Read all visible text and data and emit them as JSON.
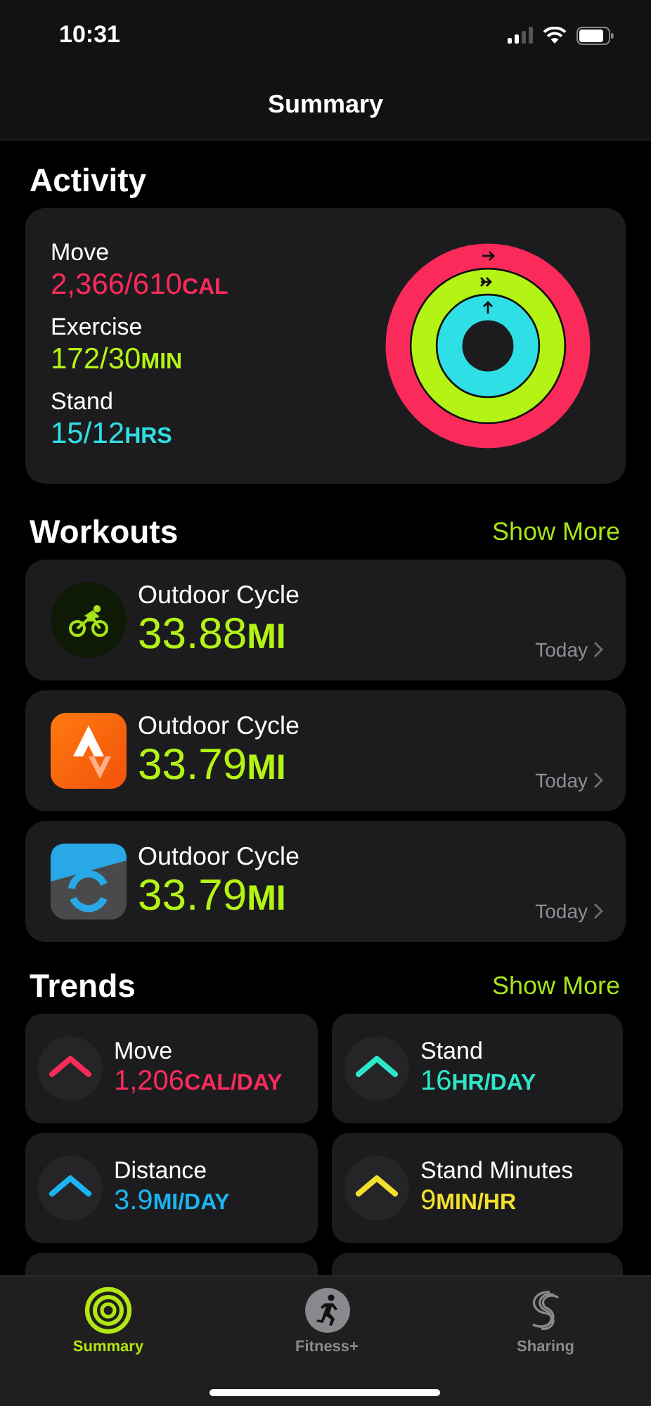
{
  "status_bar": {
    "time": "10:31"
  },
  "nav": {
    "title": "Summary"
  },
  "activity": {
    "title": "Activity",
    "metrics": [
      {
        "label": "Move",
        "value": "2,366/610",
        "unit": "CAL",
        "color": "#fa2a5a"
      },
      {
        "label": "Exercise",
        "value": "172/30",
        "unit": "MIN",
        "color": "#b4f414"
      },
      {
        "label": "Stand",
        "value": "15/12",
        "unit": "HRS",
        "color": "#2ee0e6"
      }
    ]
  },
  "workouts": {
    "title": "Workouts",
    "action": "Show More",
    "items": [
      {
        "kind": "bike",
        "title": "Outdoor Cycle",
        "value": "33.88",
        "unit": "MI",
        "date": "Today"
      },
      {
        "kind": "peaks",
        "title": "Outdoor Cycle",
        "value": "33.79",
        "unit": "MI",
        "date": "Today"
      },
      {
        "kind": "arc",
        "title": "Outdoor Cycle",
        "value": "33.79",
        "unit": "MI",
        "date": "Today"
      }
    ]
  },
  "trends": {
    "title": "Trends",
    "action": "Show More",
    "items": [
      {
        "label": "Move",
        "value": "1,206",
        "unit": "CAL/DAY",
        "color": "#fa2a5a"
      },
      {
        "label": "Stand",
        "value": "16",
        "unit": "HR/DAY",
        "color": "#2ee6c8"
      },
      {
        "label": "Distance",
        "value": "3.9",
        "unit": "MI/DAY",
        "color": "#1db4f2"
      },
      {
        "label": "Stand Minutes",
        "value": "9",
        "unit": "MIN/HR",
        "color": "#f2e02c"
      }
    ]
  },
  "tabs": [
    {
      "kind": "rings",
      "label": "Summary",
      "selected": true
    },
    {
      "kind": "runner",
      "label": "Fitness+",
      "selected": false
    },
    {
      "kind": "loop",
      "label": "Sharing",
      "selected": false
    }
  ]
}
